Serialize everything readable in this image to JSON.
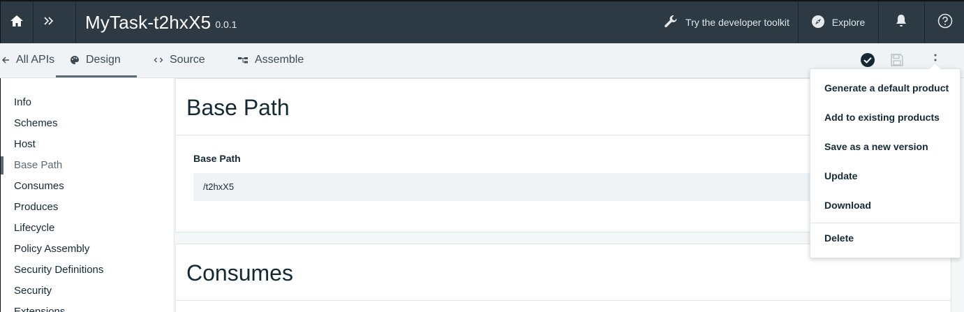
{
  "header": {
    "app_name": "MyTask-t2hxX5",
    "version": "0.0.1",
    "toolkit_label": "Try the developer toolkit",
    "explore_label": "Explore"
  },
  "tabs": {
    "all_apis": "All APIs",
    "design": "Design",
    "source": "Source",
    "assemble": "Assemble",
    "active": "Design"
  },
  "sidebar": {
    "items": [
      {
        "label": "Info"
      },
      {
        "label": "Schemes"
      },
      {
        "label": "Host"
      },
      {
        "label": "Base Path"
      },
      {
        "label": "Consumes"
      },
      {
        "label": "Produces"
      },
      {
        "label": "Lifecycle"
      },
      {
        "label": "Policy Assembly"
      },
      {
        "label": "Security Definitions"
      },
      {
        "label": "Security"
      },
      {
        "label": "Extensions"
      }
    ],
    "active": "Base Path"
  },
  "base_path_section": {
    "title": "Base Path",
    "field_label": "Base Path",
    "field_value": "/t2hxX5"
  },
  "consumes_section": {
    "title": "Consumes"
  },
  "overflow_menu": {
    "items": [
      {
        "label": "Generate a default product"
      },
      {
        "label": "Add to existing products"
      },
      {
        "label": "Save as a new version"
      },
      {
        "label": "Update"
      },
      {
        "label": "Download"
      }
    ],
    "delete_label": "Delete"
  },
  "colors": {
    "header_bg": "#2d3a43",
    "tabbar_bg": "#eff3f5",
    "main_bg": "#f4f7f8",
    "text": "#152935",
    "active_indicator": "#5a6872"
  },
  "icons": [
    "home-icon",
    "double-chevron-right-icon",
    "wrench-icon",
    "compass-icon",
    "bell-icon",
    "help-icon",
    "arrow-left-icon",
    "palette-icon",
    "code-icon",
    "assemble-icon",
    "checkmark-circle-icon",
    "save-icon",
    "overflow-menu-icon"
  ]
}
